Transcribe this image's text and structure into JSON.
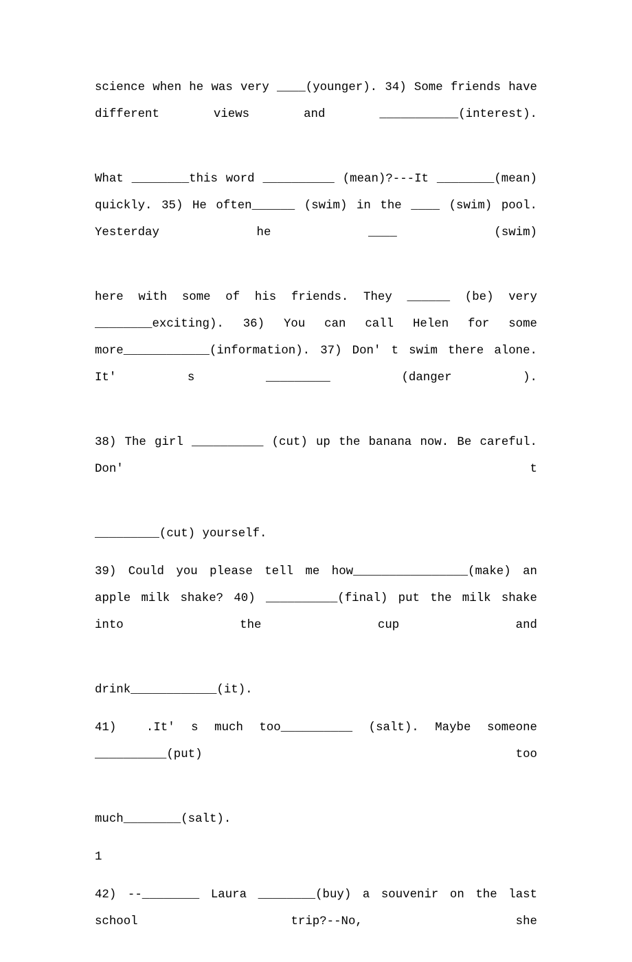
{
  "document": {
    "page_number_marker": "1",
    "font_size_px": 17,
    "text_color": "#000000",
    "background_color": "#ffffff",
    "paragraphs": [
      {
        "id": "para-33-34",
        "text": "science when he was very ____(younger). 34) Some friends have different views and ___________(interest)."
      },
      {
        "id": "para-mean-35",
        "text": "What ________this word __________ (mean)?---It ________(mean) quickly. 35) He often______ (swim) in the ____ (swim) pool. Yesterday he ____ (swim)"
      },
      {
        "id": "para-be-36-37",
        "text": "here with some of his friends. They ______ (be) very ________exciting). 36) You can call Helen for some more____________(information). 37) Don' t swim there alone. It' s _________ (danger )."
      },
      {
        "id": "para-38",
        "text": "38) The girl __________ (cut) up the banana now. Be careful. Don' t"
      },
      {
        "id": "para-38b",
        "text": "_________(cut) yourself."
      },
      {
        "id": "para-39-40",
        "text": "39) Could you please tell me how________________(make) an apple milk shake? 40) __________(final) put the milk shake into the cup and"
      },
      {
        "id": "para-40b",
        "text": "drink____________(it)."
      },
      {
        "id": "para-41",
        "text": "41)　.It' s much too__________ (salt). Maybe someone __________(put) too"
      },
      {
        "id": "para-41b",
        "text": "much________(salt)."
      },
      {
        "id": "para-page-marker",
        "text": "1"
      },
      {
        "id": "para-42",
        "text": "42) --________ Laura ________(buy) a souvenir on the last school trip?--No, she"
      }
    ]
  }
}
